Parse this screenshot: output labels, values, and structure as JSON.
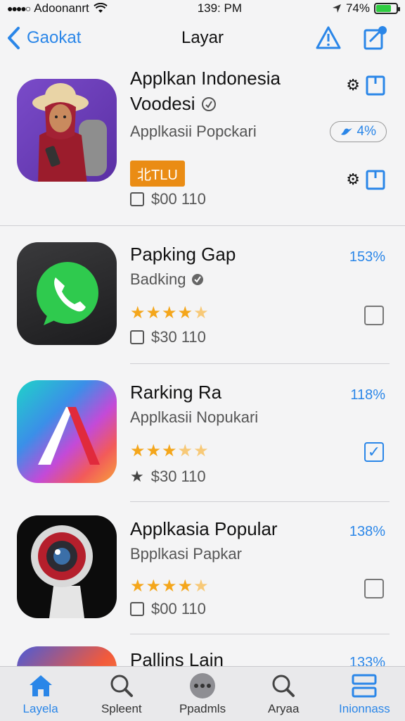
{
  "status": {
    "carrier": "Adoonanrt",
    "time": "139: PM",
    "battery": "74%",
    "battery_level": 0.74
  },
  "nav": {
    "back_label": "Gaokat",
    "title": "Layar"
  },
  "featured": {
    "name_line1": "Applkan Indonesia",
    "name_line2": "Voodesi",
    "subtitle": "Applkasii Popckari",
    "pill": "4%",
    "badge": "北TLU",
    "price": "$00 110"
  },
  "apps": [
    {
      "name": "Papking Gap",
      "subtitle": "Badking",
      "percent": "153%",
      "price": "$30 110",
      "rating": 4.5,
      "checked": false
    },
    {
      "name": "Rarking Ra",
      "subtitle": "Applkasii Nopukari",
      "percent": "118%",
      "price": "$30 110",
      "rating": 3.5,
      "checked": true
    },
    {
      "name": "Applkasia Popular",
      "subtitle": "Bpplkasi Papkar",
      "percent": "138%",
      "price": "$00 110",
      "rating": 4.5,
      "checked": false
    },
    {
      "name": "Pallins Lain",
      "percent": "133%"
    }
  ],
  "tabs": [
    {
      "label": "Layela",
      "icon": "home-icon",
      "active": true
    },
    {
      "label": "Spleent",
      "icon": "search-icon",
      "active": false
    },
    {
      "label": "Ppadmls",
      "icon": "more-icon",
      "active": false
    },
    {
      "label": "Aryaa",
      "icon": "search-icon",
      "active": false
    },
    {
      "label": "Inionnass",
      "icon": "stack-icon",
      "active": true
    }
  ],
  "colors": {
    "accent": "#2a86e8",
    "orange": "#ea8c14",
    "star": "#f4a61b"
  }
}
